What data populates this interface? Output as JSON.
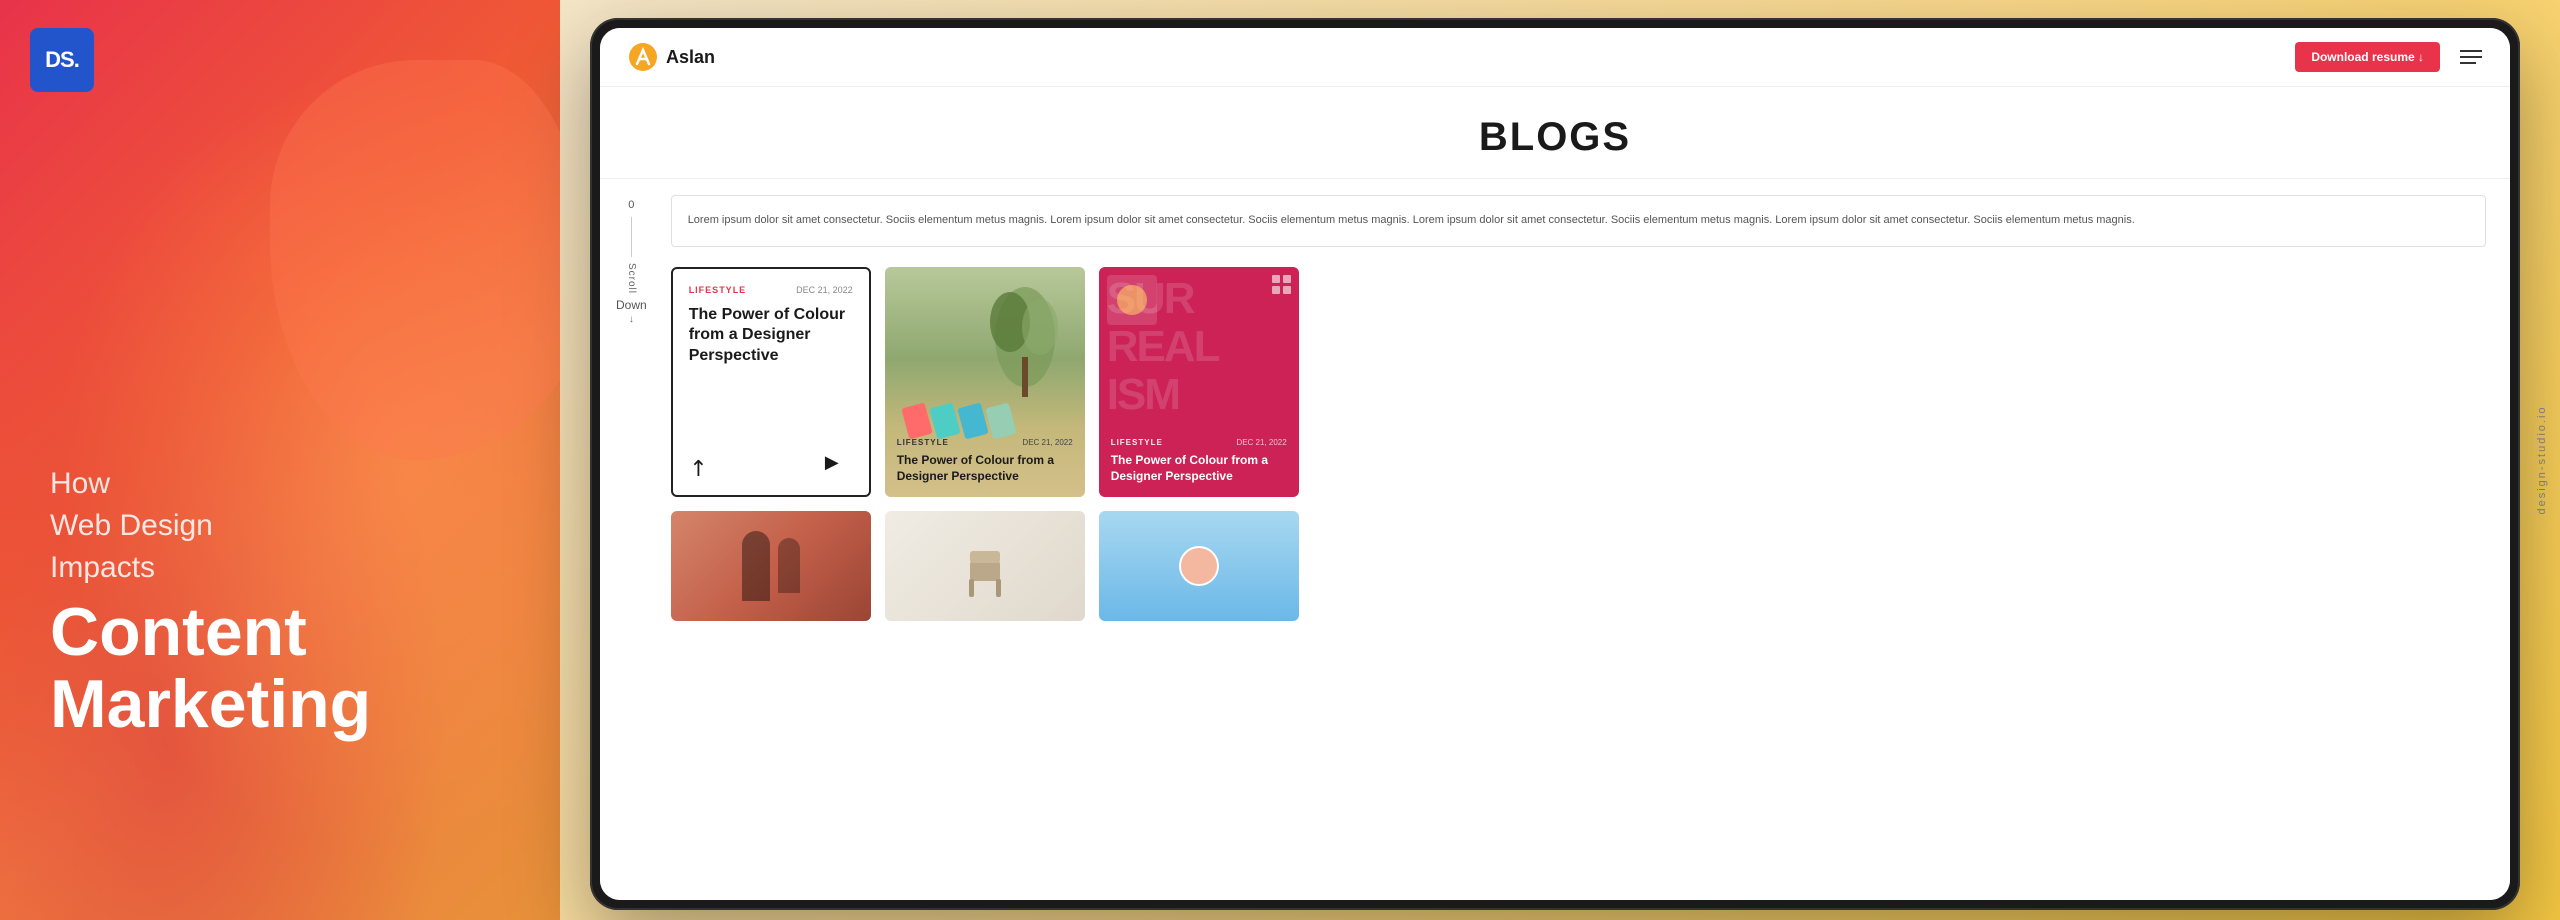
{
  "left": {
    "logo": "DS.",
    "subtitle_line1": "How",
    "subtitle_line2": "Web Design",
    "subtitle_line3": "Impacts",
    "title_line1": "Content",
    "title_line2": "Marketing"
  },
  "navbar": {
    "brand_name": "Aslan",
    "download_btn": "Download resume  ↓"
  },
  "page": {
    "blogs_heading": "BLOGS",
    "lorem_text": "Lorem ipsum dolor sit amet consectetur. Sociis elementum metus magnis. Lorem ipsum dolor sit amet consectetur. Sociis elementum metus magnis. Lorem ipsum dolor sit amet consectetur. Sociis elementum metus magnis. Lorem ipsum dolor sit amet consectetur. Sociis elementum metus magnis."
  },
  "scroll": {
    "number": "0",
    "label": "Scroll",
    "direction": "Down"
  },
  "cards": [
    {
      "tag": "LIFESTYLE",
      "date": "DEC 21, 2022",
      "title": "The Power of Colour from a Designer Perspective",
      "type": "outlined"
    },
    {
      "tag": "LIFESTYLE",
      "date": "DEC 21, 2022",
      "title": "The Power of Colour from a Designer Perspective",
      "type": "photo"
    },
    {
      "tag": "LIFESTYLE",
      "date": "DEC 21, 2022",
      "title": "The Power of Colour from a Designer Perspective",
      "type": "dark"
    }
  ],
  "site_label": "design-studio.io",
  "colors": {
    "brand_red": "#e8334a",
    "brand_blue": "#2255cc",
    "dark": "#1a1a1a"
  }
}
